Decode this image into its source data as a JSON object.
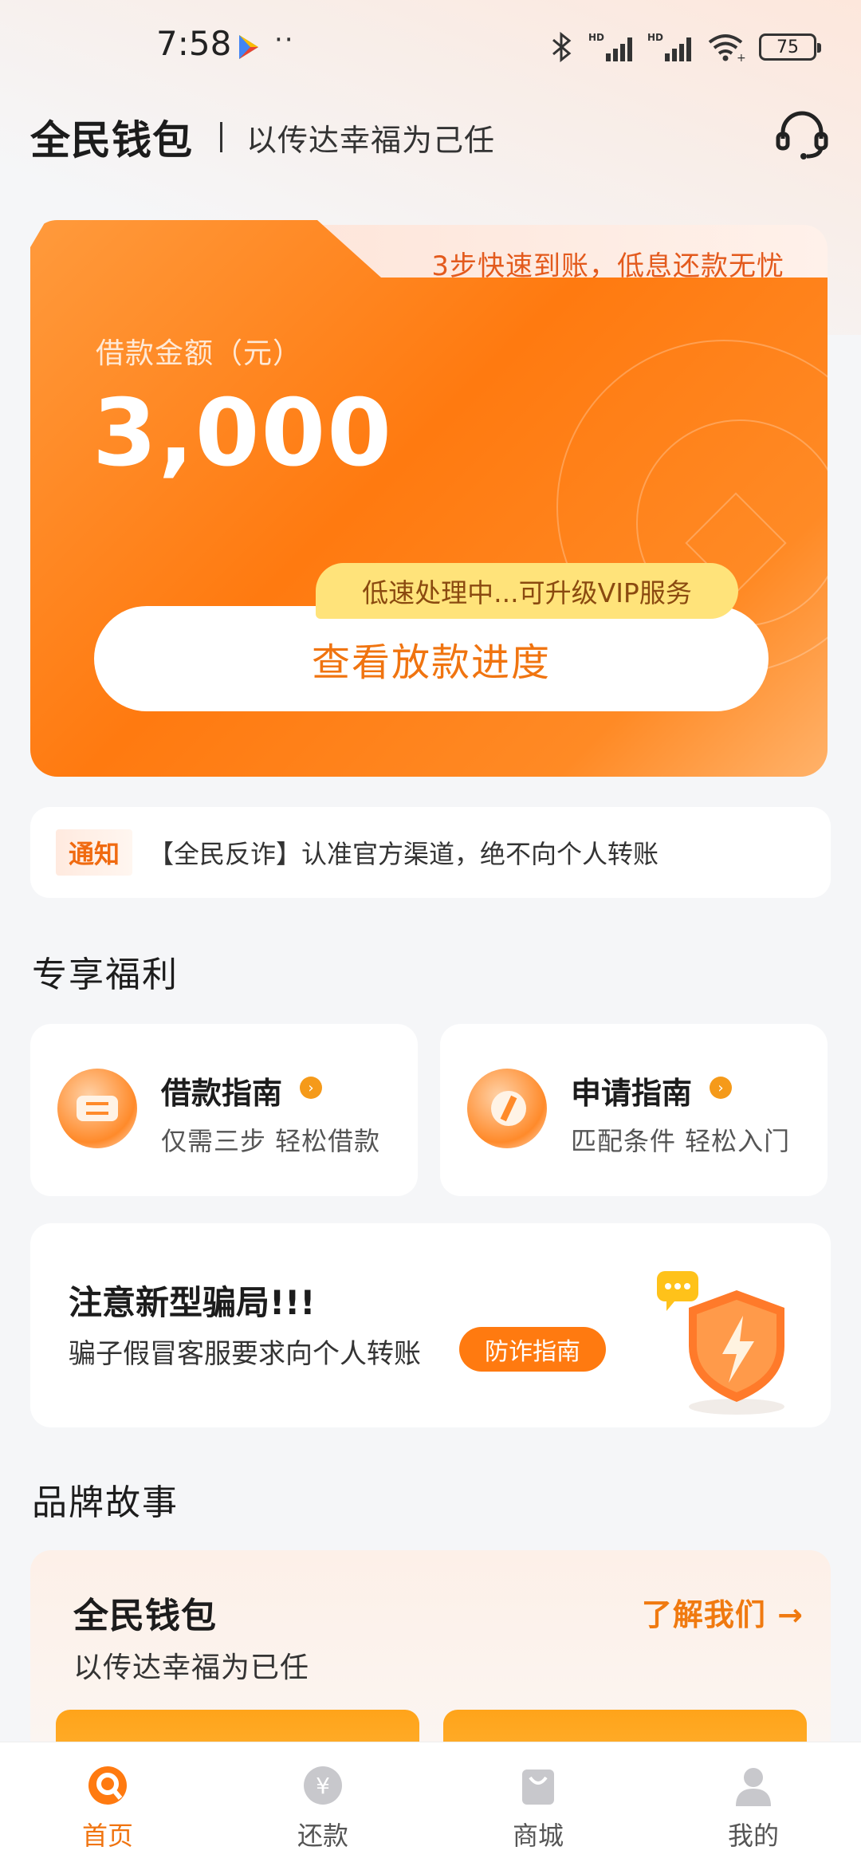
{
  "status_bar": {
    "time": "7:58",
    "dots": "··",
    "battery": "75",
    "hd1": "HD",
    "hd2": "HD"
  },
  "header": {
    "title": "全民钱包",
    "slogan": "以传达幸福为己任"
  },
  "loan_card": {
    "tab_text": "3步快速到账，低息还款无忧",
    "label": "借款金额（元）",
    "amount": "3,000",
    "tip": "低速处理中...可升级VIP服务",
    "button_label": "查看放款进度"
  },
  "notice": {
    "tag": "通知",
    "text": "【全民反诈】认准官方渠道，绝不向个人转账"
  },
  "benefits": {
    "section_title": "专享福利",
    "items": [
      {
        "title": "借款指南",
        "subtitle": "仅需三步 轻松借款"
      },
      {
        "title": "申请指南",
        "subtitle": "匹配条件 轻松入门"
      }
    ]
  },
  "fraud": {
    "title": "注意新型骗局!!!",
    "subtitle": "骗子假冒客服要求向个人转账",
    "button_label": "防诈指南"
  },
  "brand_story": {
    "section_title": "品牌故事",
    "title": "全民钱包",
    "subtitle": "以传达幸福为已任",
    "link": "了解我们 →"
  },
  "bottom_nav": {
    "items": [
      {
        "label": "首页",
        "active": true
      },
      {
        "label": "还款",
        "active": false
      },
      {
        "label": "商城",
        "active": false
      },
      {
        "label": "我的",
        "active": false
      }
    ]
  },
  "colors": {
    "accent": "#ff7a10",
    "tip_yellow": "#ffe37a",
    "background": "#f5f6f8"
  }
}
